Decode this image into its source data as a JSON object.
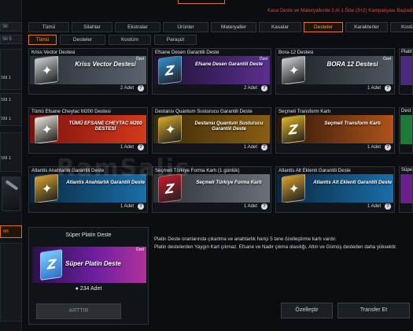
{
  "promo_text": "Kasa Deste ve Materyallerde 3 Al 1 Öde (3+2) Kampanyası Başladı",
  "categories": [
    "Tümü",
    "Silahlar",
    "Ekstralar",
    "Ürünler",
    "Materyaller",
    "Kasalar",
    "Desteler",
    "Karakterler",
    "Kostüm"
  ],
  "active_category": "Desteler",
  "subcategories": [
    "Tümü",
    "Desteler",
    "Kostüm",
    "Paraşüt"
  ],
  "active_subcategory": "Tümü",
  "sidebar": {
    "top_tab": "Sil",
    "sort_tab": "Sil 5",
    "slot_labels": [
      "Stil 1",
      "Stil 1",
      "Stil 1",
      "Stil 1"
    ],
    "highlight_label": "on"
  },
  "cards": [
    {
      "title": "Kriss Vector Destesi",
      "name": "Kriss Vector Destesi",
      "badge": "Özel",
      "count": "2 Adet",
      "glyph": "✦",
      "colors": [
        "#2a2f36",
        "#5a636d"
      ],
      "box": "#c9cdd2"
    },
    {
      "title": "Efsane Desen Garantili Deste",
      "name": "Efsane Desen Garantili Deste",
      "badge": "Özel",
      "count": "2 Adet",
      "glyph": "Z",
      "colors": [
        "#1d1230",
        "#5a2f8f"
      ],
      "box": "#2f8fd1"
    },
    {
      "title": "Bora-12 Destesi",
      "name": "BORA 12 Destesi",
      "badge": "Özel",
      "count": "1 Adet",
      "glyph": "✦",
      "colors": [
        "#1c2026",
        "#4d555e"
      ],
      "box": "#c9cdd2"
    },
    {
      "title": "Tümü Efsane Cheytac M200 Destesi",
      "name": "TÜMÜ EFSANE CHEYTAC M200 DESTESİ",
      "badge": "",
      "count": "1 Adet",
      "glyph": "✦",
      "colors": [
        "#7a1010",
        "#d43a1a"
      ],
      "box": "#e7e3d8"
    },
    {
      "title": "Destansı Quantum Susturucu Garantili Deste",
      "name": "Destansı Quantum Susturucu Garantili Deste",
      "badge": "",
      "count": "1 Adet",
      "glyph": "✦",
      "colors": [
        "#3a2a08",
        "#8a5d12"
      ],
      "box": "#d7a62a"
    },
    {
      "title": "Seçmeli Transform Kartı",
      "name": "Seçmeli Transform Kartı",
      "badge": "",
      "count": "1 Adet",
      "glyph": "Z",
      "colors": [
        "#2a1808",
        "#b0521a"
      ],
      "box": "#e0b21f"
    },
    {
      "title": "Atlantis Anahtarlık Garantili Deste",
      "name": "Atlantis Anahtarlık Garantili Deste",
      "badge": "",
      "count": "1 Adet",
      "glyph": "✦",
      "colors": [
        "#0a2740",
        "#1a6ea8"
      ],
      "box": "#d6a02a"
    },
    {
      "title": "Seçmeli Türkiye Forma Kartı (1 günlük)",
      "name": "Seçmeli Türkiye Forma Kartı",
      "badge": "",
      "count": "1 Adet",
      "glyph": "Z",
      "colors": [
        "#2e3238",
        "#6a7078"
      ],
      "box": "#c8182a"
    },
    {
      "title": "Atlantis Alt Eklenti Garantili Deste",
      "name": "Atlantis Alt Eklenti Garantili Deste",
      "badge": "",
      "count": "1 Adet",
      "glyph": "✦",
      "colors": [
        "#0a2740",
        "#1a6ea8"
      ],
      "box": "#d6a02a"
    }
  ],
  "edge_cards": [
    {
      "title": "Platin",
      "color": "#4a2a7a"
    },
    {
      "title": "Dest",
      "color": "#1f7a3a"
    },
    {
      "title": "Süpe",
      "color": "#6a1f8a"
    }
  ],
  "featured": {
    "title": "Süper Platin Deste",
    "name": "Süper Platin Deste",
    "badge": "Özel",
    "count": "234 Adet",
    "button": "ARTTIR"
  },
  "description": [
    "Platin Deste oranlarında çıkartma ve anahtarlık hariçi 5 tane özelleştirme kartı vardır.",
    "Platin destelerden Yaygın Kart çıkmaz. Efsane ve Nadir çıkma olasılığı, Altın ve Gümüş desteden daha yüksektir."
  ],
  "buttons": {
    "customize": "Özelleştir",
    "transfer": "Transfer Et"
  },
  "watermark": "RamSalis"
}
